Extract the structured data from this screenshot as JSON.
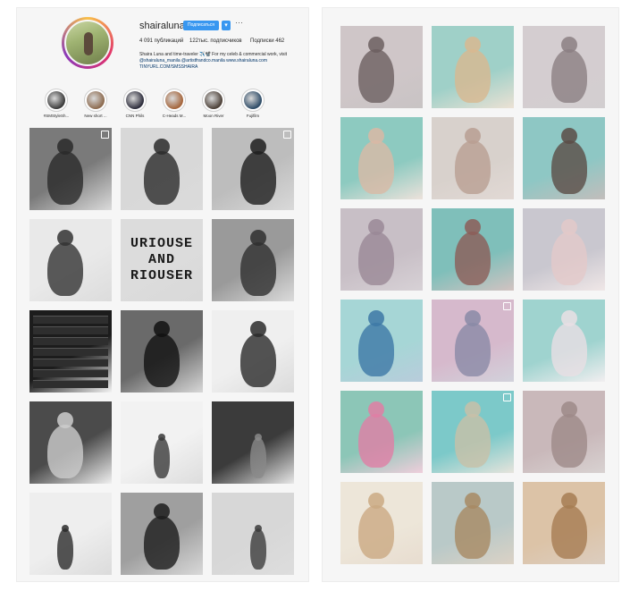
{
  "profile": {
    "username": "shairaluna",
    "follow_label": "Подписаться",
    "dropdown_glyph": "▾",
    "more_glyph": "···",
    "stats": [
      "4 091 публикаций",
      "122тыс. подписчиков",
      "Подписки 462"
    ],
    "bio_line1": "Shaira Luna and time-traveler ✈️📽️ For my celeb & commercial work, visit",
    "bio_line2": "@shairaluna_manila @artistfrandco.manila www.shairaluna.com",
    "bio_link": "TINYURL.COM/SMSSHAIRA"
  },
  "highlights": [
    {
      "label": "#SMStyleSh...",
      "color": "#3a3a3a"
    },
    {
      "label": "New short ...",
      "color": "#8c6a4e"
    },
    {
      "label": "CNN Phils",
      "color": "#2b2b3a"
    },
    {
      "label": "C-Heads M...",
      "color": "#a4643a"
    },
    {
      "label": "Moon River",
      "color": "#4b3f36"
    },
    {
      "label": "Fujifilm",
      "color": "#2c4a66"
    }
  ],
  "left_grid": [
    {
      "bg": "#7a7a7a",
      "fg": "#2a2a2a",
      "video": true,
      "kind": "portrait"
    },
    {
      "bg": "#d8d8d8",
      "fg": "#2b2b2b",
      "video": false,
      "kind": "group"
    },
    {
      "bg": "#bdbdbd",
      "fg": "#1e1e1e",
      "video": true,
      "kind": "portrait"
    },
    {
      "bg": "#e9e9e9",
      "fg": "#333333",
      "video": false,
      "kind": "portrait"
    },
    {
      "bg": "#dcdcdc",
      "fg": "#1a1a1a",
      "video": false,
      "kind": "text",
      "text": "URIOUSE\nAND\nRIOUSER"
    },
    {
      "bg": "#9a9a9a",
      "fg": "#2f2f2f",
      "video": false,
      "kind": "dog"
    },
    {
      "bg": "#1c1c1c",
      "fg": "#e6e6e6",
      "video": false,
      "kind": "board"
    },
    {
      "bg": "#6a6a6a",
      "fg": "#111111",
      "video": false,
      "kind": "portrait"
    },
    {
      "bg": "#efefef",
      "fg": "#2a2a2a",
      "video": false,
      "kind": "portrait"
    },
    {
      "bg": "#4b4b4b",
      "fg": "#cccccc",
      "video": false,
      "kind": "portrait"
    },
    {
      "bg": "#f2f2f2",
      "fg": "#3a3a3a",
      "video": false,
      "kind": "figure"
    },
    {
      "bg": "#3b3b3b",
      "fg": "#8a8a8a",
      "video": false,
      "kind": "figure"
    },
    {
      "bg": "#eeeeee",
      "fg": "#2c2c2c",
      "video": false,
      "kind": "figure"
    },
    {
      "bg": "#9f9f9f",
      "fg": "#1c1c1c",
      "video": false,
      "kind": "portrait"
    },
    {
      "bg": "#d7d7d7",
      "fg": "#3c3c3c",
      "video": false,
      "kind": "figure"
    }
  ],
  "right_grid": [
    {
      "bg": "#cfc6c8",
      "fg": "#6c5f60",
      "video": false
    },
    {
      "bg": "#9fd0c8",
      "fg": "#d8b890",
      "video": false
    },
    {
      "bg": "#d4cdd0",
      "fg": "#8b7f82",
      "video": false
    },
    {
      "bg": "#8dcac0",
      "fg": "#d9b9a5",
      "video": false
    },
    {
      "bg": "#d8d1cc",
      "fg": "#b99f92",
      "video": false
    },
    {
      "bg": "#8ec7c4",
      "fg": "#5b4c46",
      "video": false
    },
    {
      "bg": "#c8bfc6",
      "fg": "#9a8896",
      "video": false
    },
    {
      "bg": "#7fbfba",
      "fg": "#8c5d58",
      "video": false
    },
    {
      "bg": "#c9c7cf",
      "fg": "#e3c9c9",
      "video": false
    },
    {
      "bg": "#a6d6d6",
      "fg": "#3d78a6",
      "video": false
    },
    {
      "bg": "#d6b9cc",
      "fg": "#8a8aa6",
      "video": true
    },
    {
      "bg": "#9fd3cf",
      "fg": "#e9dfe4",
      "video": false
    },
    {
      "bg": "#8cc6b7",
      "fg": "#e07ea5",
      "video": false
    },
    {
      "bg": "#7cc9c9",
      "fg": "#c8c0a8",
      "video": true
    },
    {
      "bg": "#c9b8ba",
      "fg": "#9d8a88",
      "video": false
    },
    {
      "bg": "#ede6d9",
      "fg": "#caa982",
      "video": false
    },
    {
      "bg": "#b9c9c8",
      "fg": "#a78a63",
      "video": false
    },
    {
      "bg": "#dcc3a7",
      "fg": "#a67c52",
      "video": false
    }
  ]
}
